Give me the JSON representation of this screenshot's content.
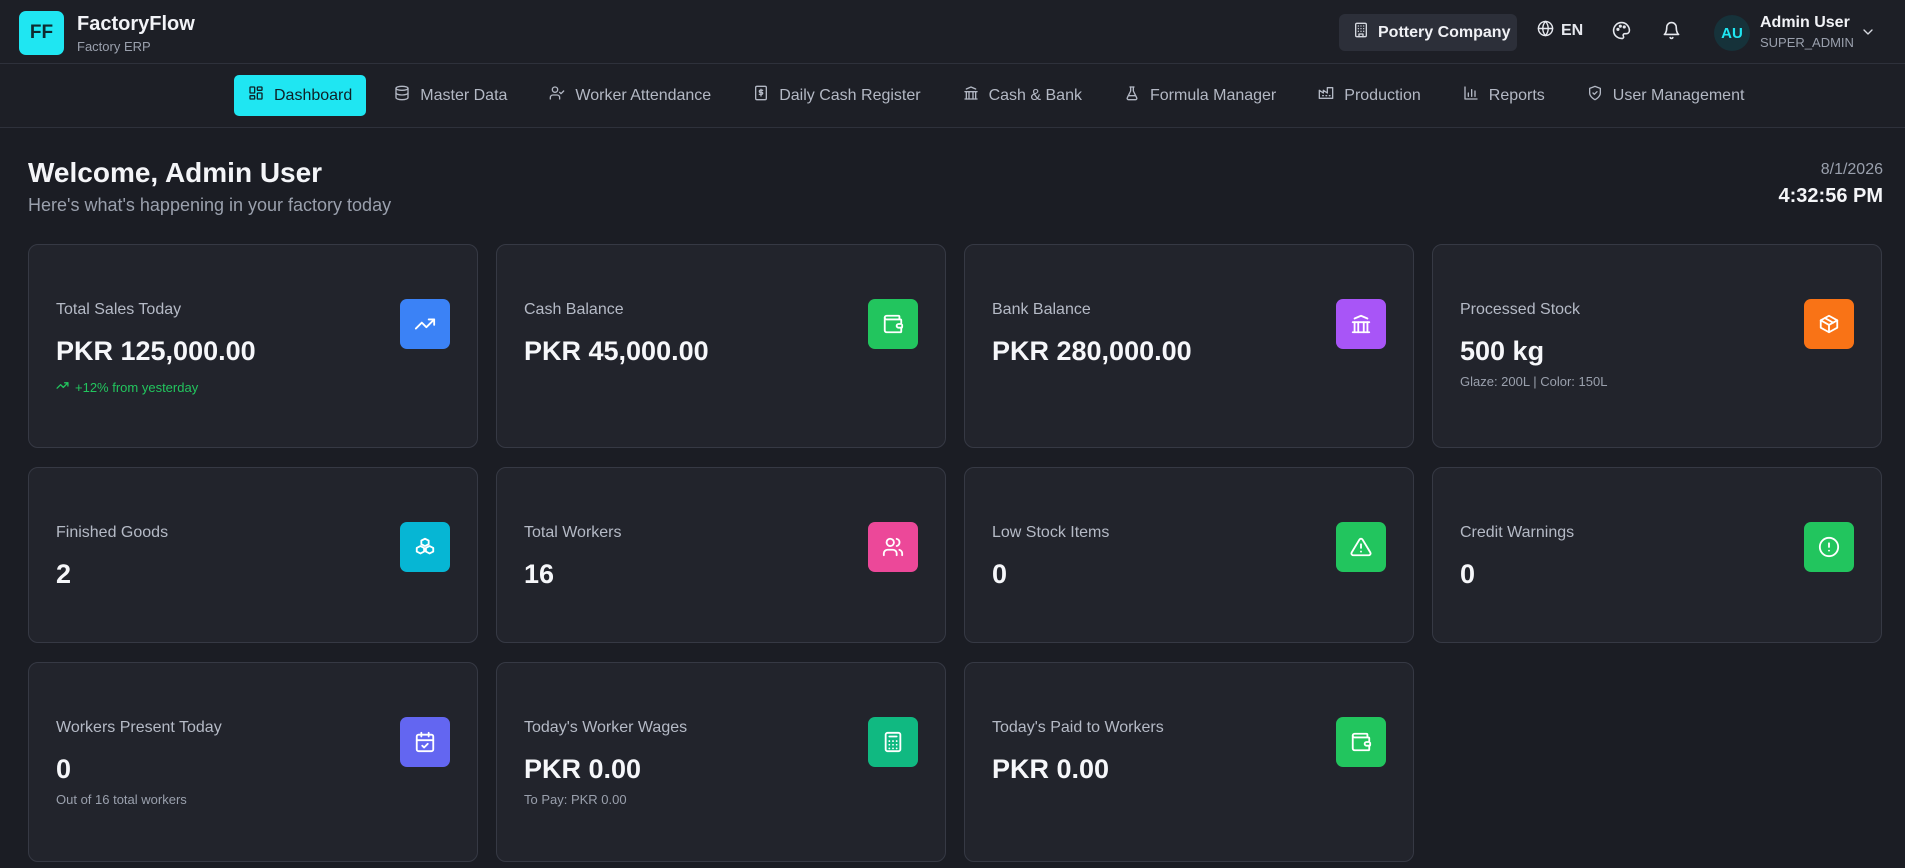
{
  "header": {
    "logo_text": "FF",
    "brand_name": "FactoryFlow",
    "brand_sub": "Factory ERP",
    "company": "Pottery Company",
    "language": "EN",
    "avatar_initials": "AU",
    "user_name": "Admin User",
    "user_role": "SUPER_ADMIN"
  },
  "nav": {
    "items": [
      {
        "label": "Dashboard",
        "icon": "dashboard-icon",
        "active": true
      },
      {
        "label": "Master Data",
        "icon": "database-icon"
      },
      {
        "label": "Worker Attendance",
        "icon": "user-check-icon"
      },
      {
        "label": "Daily Cash Register",
        "icon": "receipt-dollar-icon"
      },
      {
        "label": "Cash & Bank",
        "icon": "bank-icon"
      },
      {
        "label": "Formula Manager",
        "icon": "flask-icon"
      },
      {
        "label": "Production",
        "icon": "factory-icon"
      },
      {
        "label": "Reports",
        "icon": "bar-chart-icon"
      },
      {
        "label": "User Management",
        "icon": "shield-check-icon"
      }
    ]
  },
  "welcome": {
    "title": "Welcome, Admin User",
    "subtitle": "Here's what's happening in your factory today",
    "date": "8/1/2026",
    "time": "4:32:56 PM"
  },
  "colors": {
    "accent": "#1fe6f2",
    "blue": "#3b82f6",
    "green": "#22c55e",
    "purple": "#a855f7",
    "orange": "#f97316",
    "cyan": "#06b6d4",
    "pink": "#ec4899",
    "indigo": "#6366f1",
    "emerald": "#10b981"
  },
  "cards": {
    "total_sales": {
      "label": "Total Sales Today",
      "value": "PKR 125,000.00",
      "sub": "+12% from yesterday",
      "icon": "trending-up-icon"
    },
    "cash_balance": {
      "label": "Cash Balance",
      "value": "PKR 45,000.00",
      "icon": "wallet-icon"
    },
    "bank_balance": {
      "label": "Bank Balance",
      "value": "PKR 280,000.00",
      "icon": "bank-icon"
    },
    "processed_stock": {
      "label": "Processed Stock",
      "value": "500 kg",
      "sub": "Glaze: 200L | Color: 150L",
      "icon": "box-icon"
    },
    "finished_goods": {
      "label": "Finished Goods",
      "value": "2",
      "icon": "boxes-icon"
    },
    "total_workers": {
      "label": "Total Workers",
      "value": "16",
      "icon": "users-icon"
    },
    "low_stock": {
      "label": "Low Stock Items",
      "value": "0",
      "icon": "alert-triangle-icon"
    },
    "credit_warnings": {
      "label": "Credit Warnings",
      "value": "0",
      "icon": "alert-circle-icon"
    },
    "workers_present": {
      "label": "Workers Present Today",
      "value": "0",
      "sub": "Out of 16 total workers",
      "icon": "calendar-check-icon"
    },
    "worker_wages": {
      "label": "Today's Worker Wages",
      "value": "PKR 0.00",
      "sub": "To Pay: PKR 0.00",
      "icon": "calculator-icon"
    },
    "paid_workers": {
      "label": "Today's Paid to Workers",
      "value": "PKR 0.00",
      "icon": "wallet-icon"
    }
  }
}
